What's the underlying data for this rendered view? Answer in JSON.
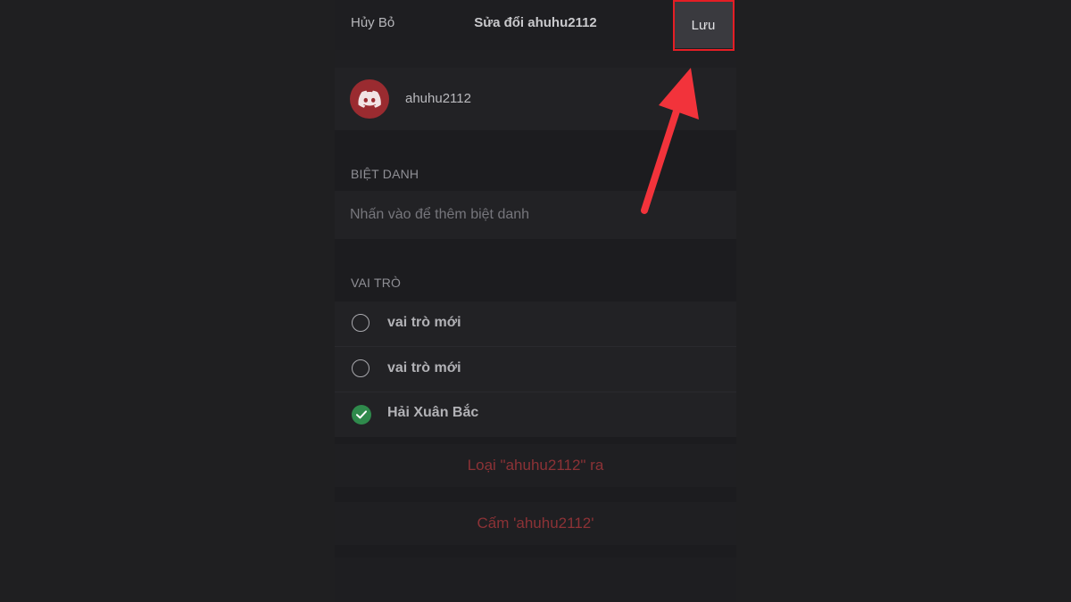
{
  "header": {
    "cancel_label": "Hủy Bỏ",
    "title": "Sửa đổi ahuhu2112",
    "save_label": "Lưu"
  },
  "member": {
    "username": "ahuhu2112",
    "avatar_icon": "discord-logo-icon",
    "avatar_color": "#9a2b30"
  },
  "nickname": {
    "section_label": "BIỆT DANH",
    "placeholder": "Nhấn vào để thêm biệt danh"
  },
  "roles": {
    "section_label": "VAI TRÒ",
    "items": [
      {
        "label": "vai trò mới",
        "checked": false
      },
      {
        "label": "vai trò mới",
        "checked": false
      },
      {
        "label": "Hải Xuân Bắc",
        "checked": true
      }
    ]
  },
  "actions": {
    "kick_label": "Loại \"ahuhu2112\" ra",
    "ban_label": "Cấm 'ahuhu2112'"
  },
  "annotation": {
    "highlight_color": "#e51e25",
    "arrow_color": "#f2333b"
  }
}
